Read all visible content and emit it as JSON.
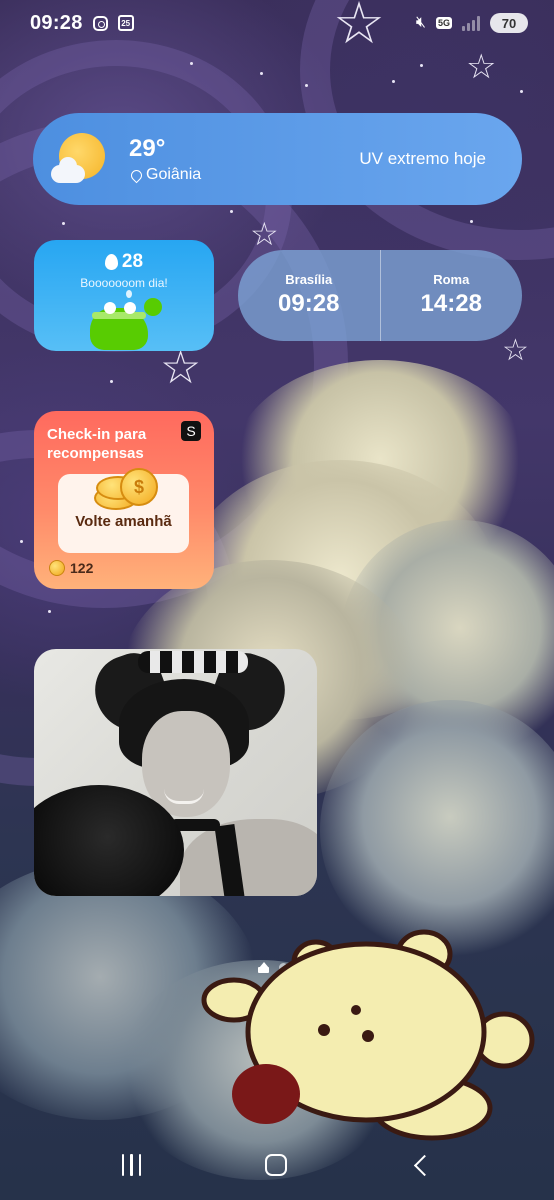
{
  "status_bar": {
    "time": "09:28",
    "calendar_day": "25",
    "network": "5G",
    "battery": "70",
    "icons": [
      "instagram-icon",
      "calendar-icon",
      "mute-icon",
      "5g-icon",
      "signal-icon",
      "battery-icon"
    ]
  },
  "weather": {
    "temperature": "29°",
    "city": "Goiânia",
    "alert": "UV extremo hoje",
    "icon": "partly-sunny-icon"
  },
  "duolingo": {
    "streak": "28",
    "message": "Booooooom dia!",
    "icon": "flame-icon"
  },
  "world_clock": {
    "cities": [
      {
        "name": "Brasília",
        "time": "09:28"
      },
      {
        "name": "Roma",
        "time": "14:28"
      }
    ]
  },
  "checkin": {
    "title": "Check-in para recompensas",
    "logo": "S",
    "cta": "Volte amanhã",
    "points": "122",
    "coin_symbol": "$"
  },
  "pager": {
    "pages": 2,
    "current": 1
  },
  "navbar": {
    "items": [
      "recents-icon",
      "home-icon",
      "back-icon"
    ]
  },
  "colors": {
    "weather_pill": "#5a9ae6",
    "duolingo_bg": "#27a6f2",
    "checkin_bg": "#ff7a62",
    "clock_bg": "#7da5d7"
  }
}
